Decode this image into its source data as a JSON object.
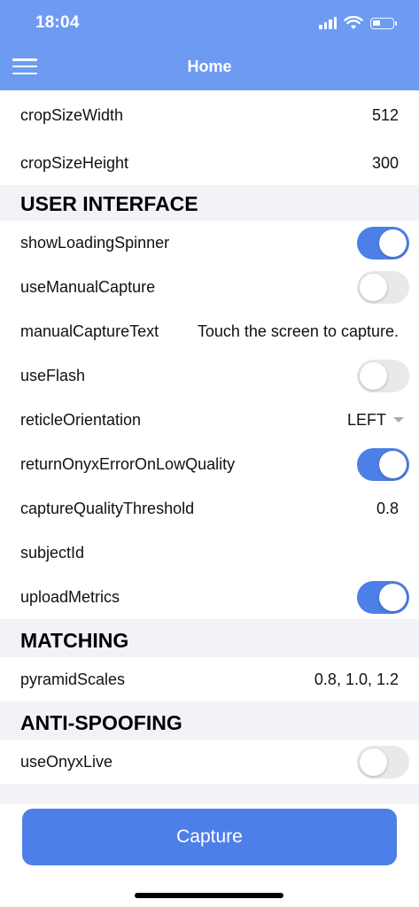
{
  "status": {
    "time": "18:04"
  },
  "header": {
    "title": "Home"
  },
  "rows_top": [
    {
      "label": "cropSizeWidth",
      "value": "512"
    },
    {
      "label": "cropSizeHeight",
      "value": "300"
    }
  ],
  "sections": {
    "ui": "USER INTERFACE",
    "matching": "MATCHING",
    "antispoof": "ANTI-SPOOFING"
  },
  "ui": {
    "showLoadingSpinner": {
      "label": "showLoadingSpinner",
      "on": true
    },
    "useManualCapture": {
      "label": "useManualCapture",
      "on": false
    },
    "manualCaptureText": {
      "label": "manualCaptureText",
      "value": "Touch the screen to capture."
    },
    "useFlash": {
      "label": "useFlash",
      "on": false
    },
    "reticleOrientation": {
      "label": "reticleOrientation",
      "value": "LEFT"
    },
    "returnOnyxErrorOnLowQuality": {
      "label": "returnOnyxErrorOnLowQuality",
      "on": true
    },
    "captureQualityThreshold": {
      "label": "captureQualityThreshold",
      "value": "0.8"
    },
    "subjectId": {
      "label": "subjectId",
      "value": ""
    },
    "uploadMetrics": {
      "label": "uploadMetrics",
      "on": true
    }
  },
  "matching": {
    "pyramidScales": {
      "label": "pyramidScales",
      "value": "0.8, 1.0, 1.2"
    }
  },
  "antispoof": {
    "useOnyxLive": {
      "label": "useOnyxLive",
      "on": false
    }
  },
  "footer": {
    "capture_label": "Capture"
  },
  "colors": {
    "header": "#6d9bf2",
    "accent": "#4d7fe8",
    "toggle_off": "#e9e9eb"
  }
}
